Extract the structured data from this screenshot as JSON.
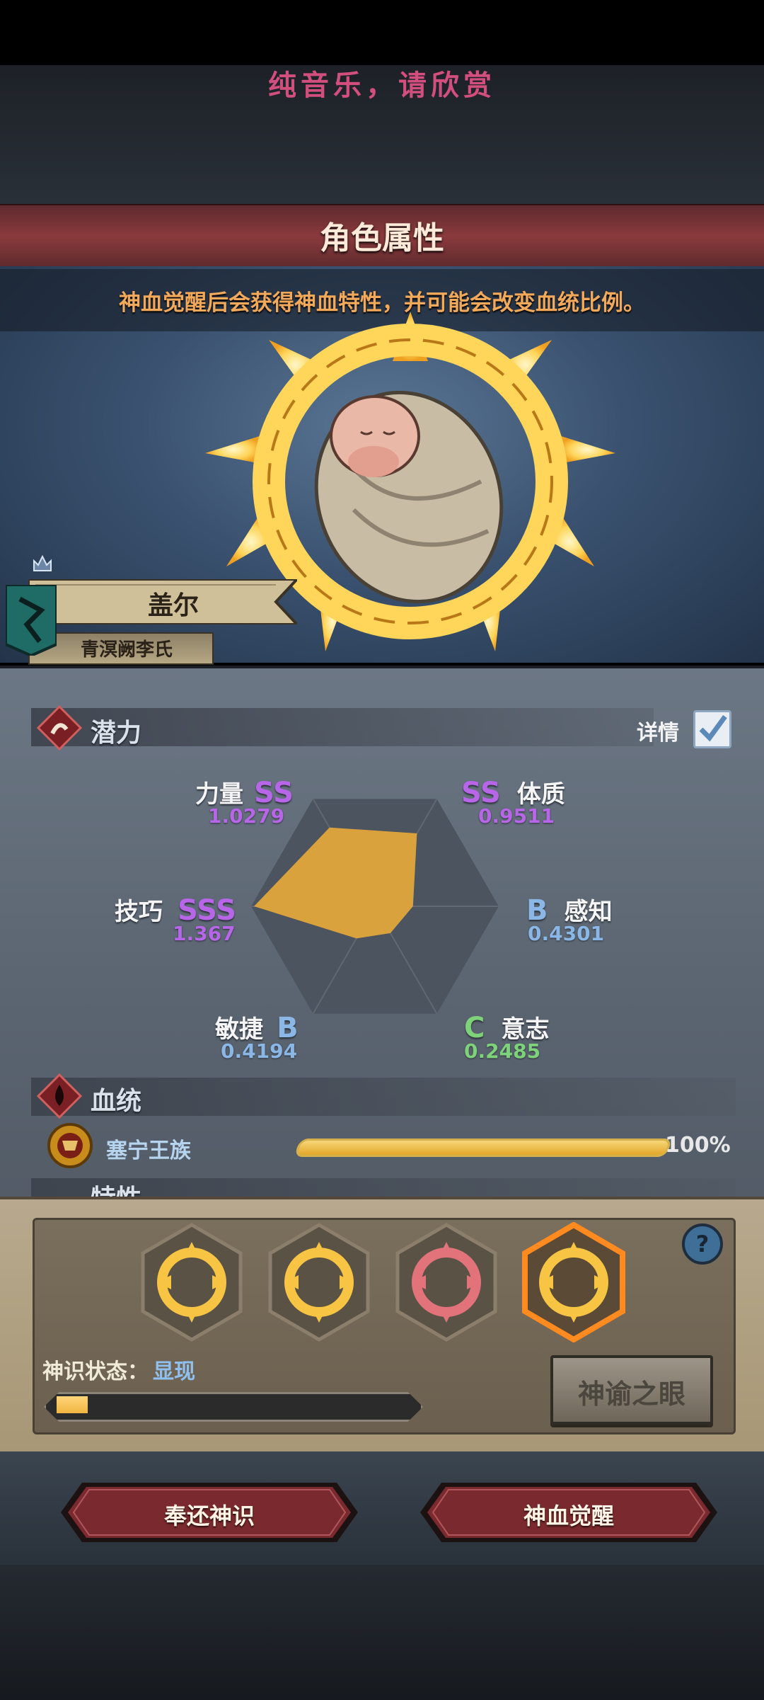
{
  "header": {
    "caption": "纯音乐，请欣赏",
    "title": "角色属性"
  },
  "hero": {
    "description": "神血觉醒后会获得神血特性，并可能会改变血统比例。",
    "name": "盖尔",
    "clan": "青溟阙李氏"
  },
  "potential": {
    "label": "潜力",
    "detail_label": "详情",
    "detail_checked": true,
    "stats": [
      {
        "name": "力量",
        "grade": "SS",
        "value": "1.0279"
      },
      {
        "name": "体质",
        "grade": "SS",
        "value": "0.9511"
      },
      {
        "name": "感知",
        "grade": "B",
        "value": "0.4301"
      },
      {
        "name": "意志",
        "grade": "C",
        "value": "0.2485"
      },
      {
        "name": "敏捷",
        "grade": "B",
        "value": "0.4194"
      },
      {
        "name": "技巧",
        "grade": "SSS",
        "value": "1.367"
      }
    ]
  },
  "bloodline": {
    "label": "血统",
    "items": [
      {
        "name": "塞宁王族",
        "percent": "100%",
        "fraction": 1.0
      }
    ]
  },
  "traits": {
    "label": "特性"
  },
  "divine": {
    "slots": [
      "sun-ring-icon",
      "sun-ring-icon",
      "sun-ring-icon",
      "sun-ring-icon"
    ],
    "selected_slot": 4,
    "state_label": "神识状态：",
    "state_value": "显现",
    "progress": 0.09,
    "eye_button": "神谕之眼"
  },
  "actions": {
    "return_label": "奉还神识",
    "awaken_label": "神血觉醒"
  },
  "colors": {
    "grade_ss": "#b766e8",
    "grade_b": "#8bb7e6",
    "grade_c": "#7dd27a",
    "radar_fill": "#d9a23c",
    "accent_red": "#7a2a2e"
  }
}
